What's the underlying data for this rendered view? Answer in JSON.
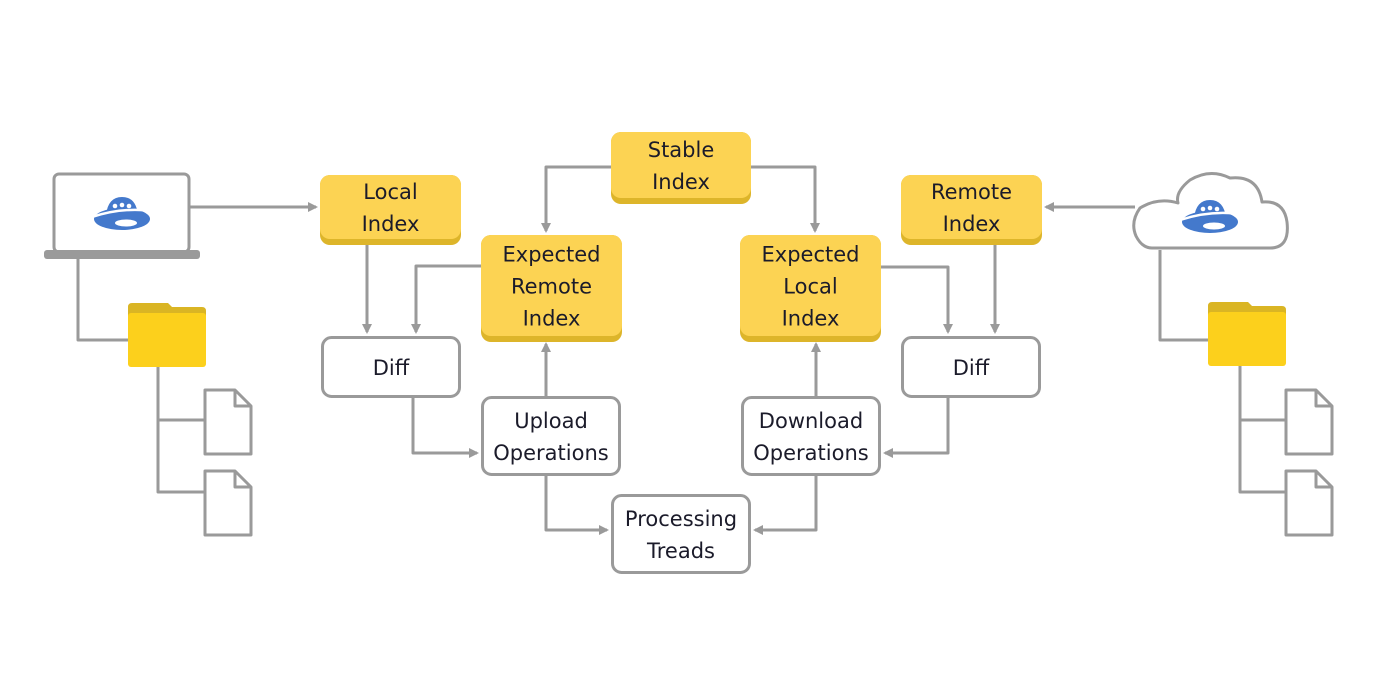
{
  "colors": {
    "index_fill": "#FCD353",
    "index_shadow": "#DDB52A",
    "connector": "#9A9A9A",
    "folder": "#FCD01C",
    "folder_tab": "#DAB524",
    "logo": "#4479CC"
  },
  "icons": {
    "client": "laptop-icon",
    "server": "cloud-icon",
    "logo": "ufo-logo-icon",
    "folder": "folder-icon",
    "file": "file-icon"
  },
  "nodes": {
    "stable_index": [
      "Stable",
      "Index"
    ],
    "local_index": [
      "Local",
      "Index"
    ],
    "remote_index": [
      "Remote",
      "Index"
    ],
    "expected_remote_index": [
      "Expected",
      "Remote",
      "Index"
    ],
    "expected_local_index": [
      "Expected",
      "Local",
      "Index"
    ],
    "diff_left": [
      "Diff"
    ],
    "diff_right": [
      "Diff"
    ],
    "upload_operations": [
      "Upload",
      "Operations"
    ],
    "download_operations": [
      "Download",
      "Operations"
    ],
    "processing_treads": [
      "Processing",
      "Treads"
    ]
  }
}
